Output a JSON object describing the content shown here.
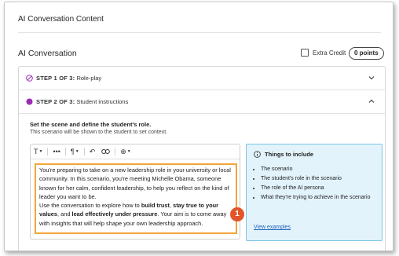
{
  "page_title": "AI Conversation Content",
  "section": {
    "title": "AI Conversation",
    "extra_credit_label": "Extra Credit",
    "points_label": "0 points"
  },
  "steps": [
    {
      "step_label": "STEP 1 OF 3:",
      "name": "Role-play",
      "status_color": "#9b2cb5",
      "state": "collapsed"
    },
    {
      "step_label": "STEP 2 OF 3:",
      "name": "Student instructions",
      "status_color": "#9b2cb5",
      "state": "expanded"
    }
  ],
  "instructions": {
    "title": "Set the scene and define the student's role.",
    "subtitle": "This scenario will be shown to the student to set context."
  },
  "editor": {
    "toolbar": [
      "T",
      "•••",
      "¶",
      "↶",
      "link",
      "⊕"
    ],
    "paragraph1": "You're preparing to take on a new leadership role in your university or local community. In this scenario, you're meeting Michelle Obama, someone known for her calm, confident leadership, to help you reflect on the kind of leader you want to be.",
    "p2_prefix": "Use the conversation to explore how to ",
    "p2_bold1": "build trust",
    "p2_sep1": ", ",
    "p2_bold2": "stay true to your values",
    "p2_mid": ", and ",
    "p2_bold3": "lead effectively under pressure",
    "p2_suffix": ". Your aim is to come away with insights that will help shape your own leadership approach."
  },
  "badge": "1",
  "tips": {
    "title": "Things to include",
    "items": [
      "The scenario",
      "The student's role in the scenario",
      "The role of the AI persona",
      "What they're trying to achieve in the scenario"
    ],
    "link": "View examples"
  },
  "colors": {
    "highlight": "#f2a53a",
    "badge": "#e2552b",
    "tips_background": "#e2f3fb",
    "tips_border": "#7cc6e8",
    "link": "#1f5fbf"
  }
}
